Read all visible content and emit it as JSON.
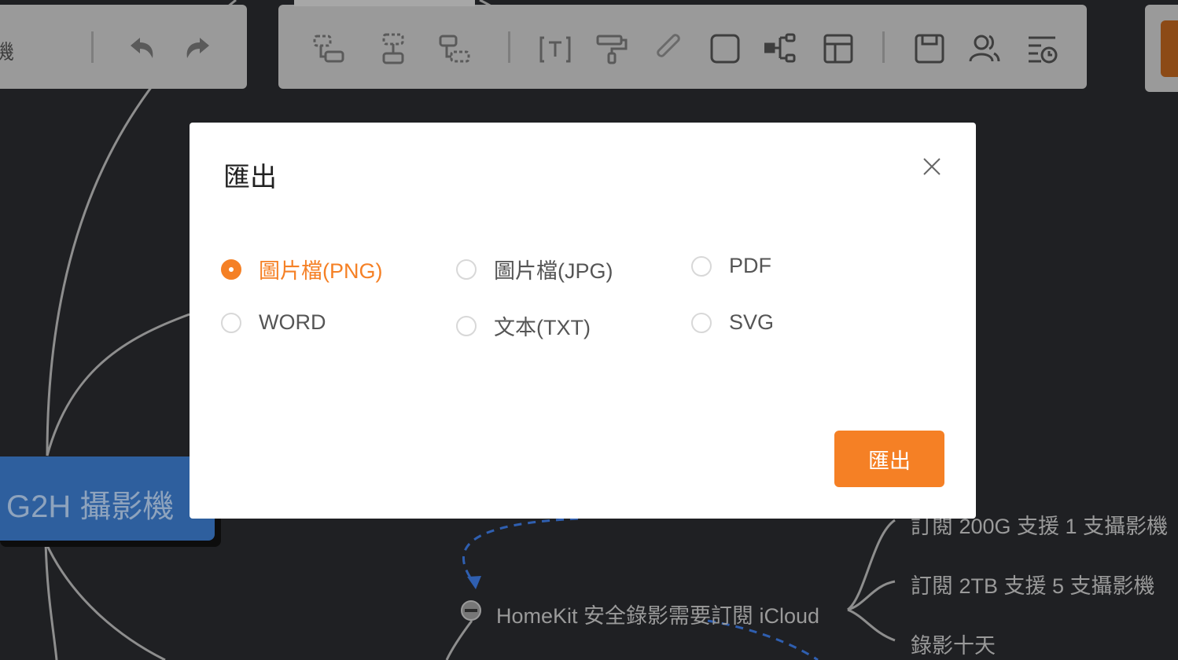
{
  "toolbar": {
    "left_text": "機",
    "undo_icon": "undo-icon",
    "redo_icon": "redo-icon",
    "icons": [
      "add-sibling-icon",
      "add-child-icon",
      "add-parent-icon",
      "text-icon",
      "format-painter-icon",
      "attachment-icon",
      "border-icon",
      "structure-icon",
      "layout-icon",
      "save-icon",
      "collaborators-icon",
      "history-icon"
    ]
  },
  "mindmap": {
    "root_label": "G2H 攝影機",
    "node_homekit": "HomeKit 安全錄影需要訂閱 iCloud",
    "child_1": "訂閱 200G 支援 1 支攝影機",
    "child_2": "訂閱 2TB 支援 5 支攝影機",
    "child_3": "錄影十天"
  },
  "dialog": {
    "title": "匯出",
    "close_icon": "close-icon",
    "options": [
      {
        "label": "圖片檔(PNG)",
        "selected": true
      },
      {
        "label": "圖片檔(JPG)",
        "selected": false
      },
      {
        "label": "PDF",
        "selected": false
      },
      {
        "label": "WORD",
        "selected": false
      },
      {
        "label": "文本(TXT)",
        "selected": false
      },
      {
        "label": "SVG",
        "selected": false
      }
    ],
    "submit_label": "匯出"
  },
  "colors": {
    "accent": "#f58025",
    "background": "#1f2023",
    "root_node": "#2e5f9e"
  }
}
